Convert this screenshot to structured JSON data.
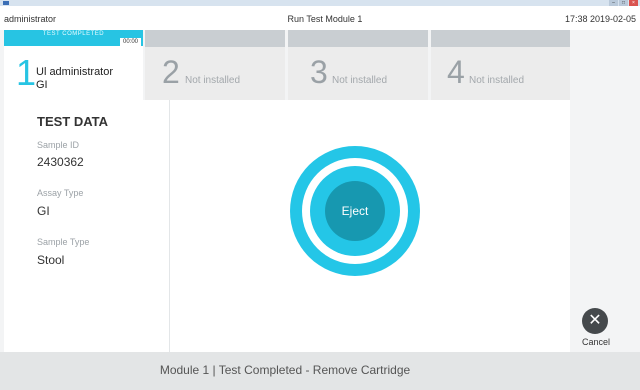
{
  "window": {
    "close_glyph": "×",
    "minimize_glyph": "–",
    "maximize_glyph": "□"
  },
  "titlebar": {
    "user": "administrator",
    "title": "Run Test Module 1",
    "datetime": "17:38 2019-02-05"
  },
  "modules": [
    {
      "number": "1",
      "status": "TEST COMPLETED",
      "timer": "00:00",
      "user": "Ul administrator",
      "assay": "GI"
    },
    {
      "number": "2",
      "label": "Not installed"
    },
    {
      "number": "3",
      "label": "Not installed"
    },
    {
      "number": "4",
      "label": "Not installed"
    }
  ],
  "test_data": {
    "heading": "TEST DATA",
    "sample_id_label": "Sample ID",
    "sample_id": "2430362",
    "assay_type_label": "Assay Type",
    "assay_type": "GI",
    "sample_type_label": "Sample Type",
    "sample_type": "Stool"
  },
  "eject": {
    "label": "Eject"
  },
  "cancel": {
    "glyph": "✕",
    "label": "Cancel"
  },
  "status": {
    "message": "Module 1  |  Test Completed - Remove Cartridge"
  },
  "colors": {
    "accent": "#27c4e3",
    "eject_core": "#1798b0",
    "cancel": "#45494c"
  }
}
